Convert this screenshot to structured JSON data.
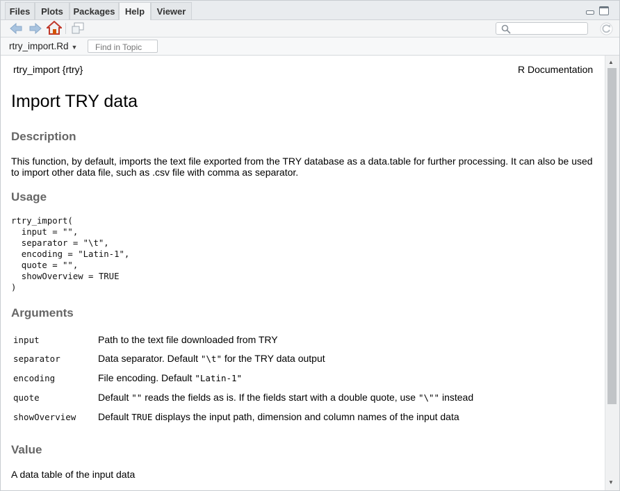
{
  "tabs": [
    "Files",
    "Plots",
    "Packages",
    "Help",
    "Viewer"
  ],
  "active_tab": "Help",
  "toolbar": {
    "back_icon": "back-arrow-icon",
    "forward_icon": "forward-arrow-icon",
    "home_icon": "home-icon",
    "popout_icon": "show-in-window-icon",
    "search_icon": "search-icon",
    "refresh_icon": "refresh-icon"
  },
  "subbar": {
    "topic": "rtry_import.Rd",
    "find_placeholder": "Find in Topic"
  },
  "doc": {
    "header_left": "rtry_import {rtry}",
    "header_right": "R Documentation",
    "title": "Import TRY data",
    "description_heading": "Description",
    "description_text": "This function, by default, imports the text file exported from the TRY database as a data.table for further processing. It can also be used to import other data file, such as .csv file with comma as separator.",
    "usage_heading": "Usage",
    "usage_code": "rtry_import(\n  input = \"\",\n  separator = \"\\t\",\n  encoding = \"Latin-1\",\n  quote = \"\",\n  showOverview = TRUE\n)",
    "arguments_heading": "Arguments",
    "args": [
      {
        "name": "input",
        "pre": "Path to the text file downloaded from TRY",
        "code1": "",
        "mid": "",
        "code2": "",
        "post": ""
      },
      {
        "name": "separator",
        "pre": "Data separator. Default ",
        "code1": "\"\\t\"",
        "mid": " for the TRY data output",
        "code2": "",
        "post": ""
      },
      {
        "name": "encoding",
        "pre": "File encoding. Default ",
        "code1": "\"Latin-1\"",
        "mid": "",
        "code2": "",
        "post": ""
      },
      {
        "name": "quote",
        "pre": "Default ",
        "code1": "\"\"",
        "mid": " reads the fields as is. If the fields start with a double quote, use ",
        "code2": "\"\\\"\"",
        "post": " instead"
      },
      {
        "name": "showOverview",
        "pre": "Default ",
        "code1": "TRUE",
        "mid": " displays the input path, dimension and column names of the input data",
        "code2": "",
        "post": ""
      }
    ],
    "value_heading": "Value",
    "value_text": "A data table of the input data"
  }
}
